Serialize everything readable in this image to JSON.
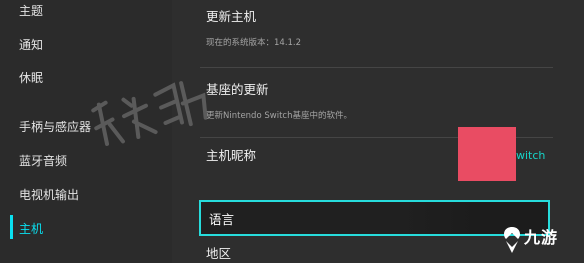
{
  "sidebar": {
    "items": [
      {
        "label": "主题"
      },
      {
        "label": "通知"
      },
      {
        "label": "休眠"
      },
      {
        "label": "手柄与感应器"
      },
      {
        "label": "蓝牙音频"
      },
      {
        "label": "电视机输出"
      },
      {
        "label": "主机"
      }
    ],
    "active_index": 6
  },
  "main": {
    "update": {
      "title": "更新主机",
      "subtitle": "现在的系统版本：14.1.2"
    },
    "dock_update": {
      "title": "基座的更新",
      "subtitle": "更新Nintendo Switch基座中的软件。"
    },
    "nickname": {
      "title": "主机昵称",
      "value_tail": "witch"
    },
    "language": {
      "title": "语言"
    },
    "region": {
      "title": "地区"
    }
  },
  "logo": {
    "text": "九游"
  },
  "colors": {
    "accent": "#0ae0f0",
    "focus_border": "#27dcdc",
    "redaction": "#e94c63",
    "background": "#2d2d2d"
  }
}
